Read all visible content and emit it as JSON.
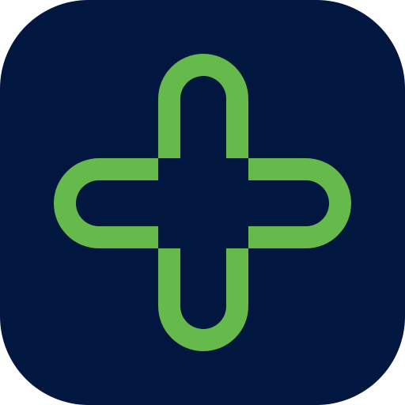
{
  "icon": {
    "name": "plus-cross-icon",
    "background_color": "#01173F",
    "outline_color": "#66BA4C",
    "inner_color": "#01173F"
  }
}
